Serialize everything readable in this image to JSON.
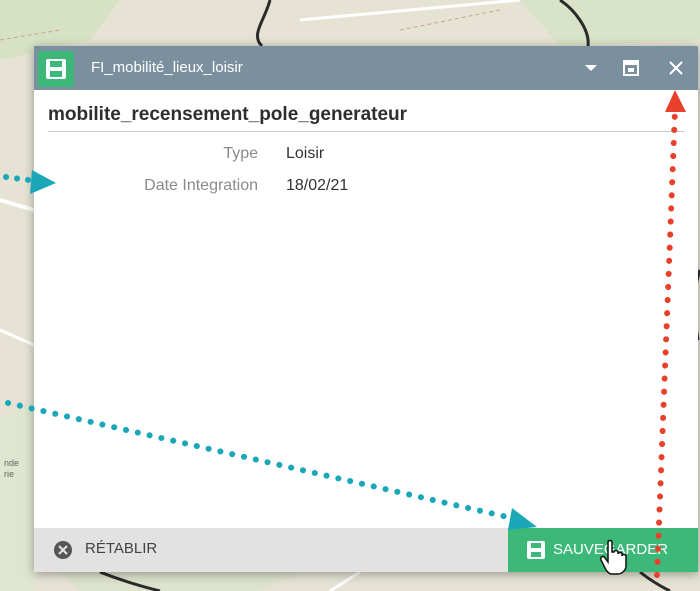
{
  "window": {
    "title": "FI_mobilité_lieux_loisir",
    "icon": "save-icon",
    "controls": [
      "chevron-down-icon",
      "restore-icon",
      "close-icon"
    ]
  },
  "layer": {
    "name": "mobilite_recensement_pole_generateur"
  },
  "fields": [
    {
      "label": "Type",
      "value": "Loisir"
    },
    {
      "label": "Date Integration",
      "value": "18/02/21"
    }
  ],
  "footer": {
    "reset_label": "RÉTABLIR",
    "save_label": "SAUVEGARDER"
  },
  "map_labels": [
    "nde",
    "rie"
  ],
  "colors": {
    "titlebar": "#7b909f",
    "accent": "#3cb878",
    "footer": "#e2e2e2",
    "annotation_teal": "#1aa8b8",
    "annotation_red": "#e8402a"
  }
}
